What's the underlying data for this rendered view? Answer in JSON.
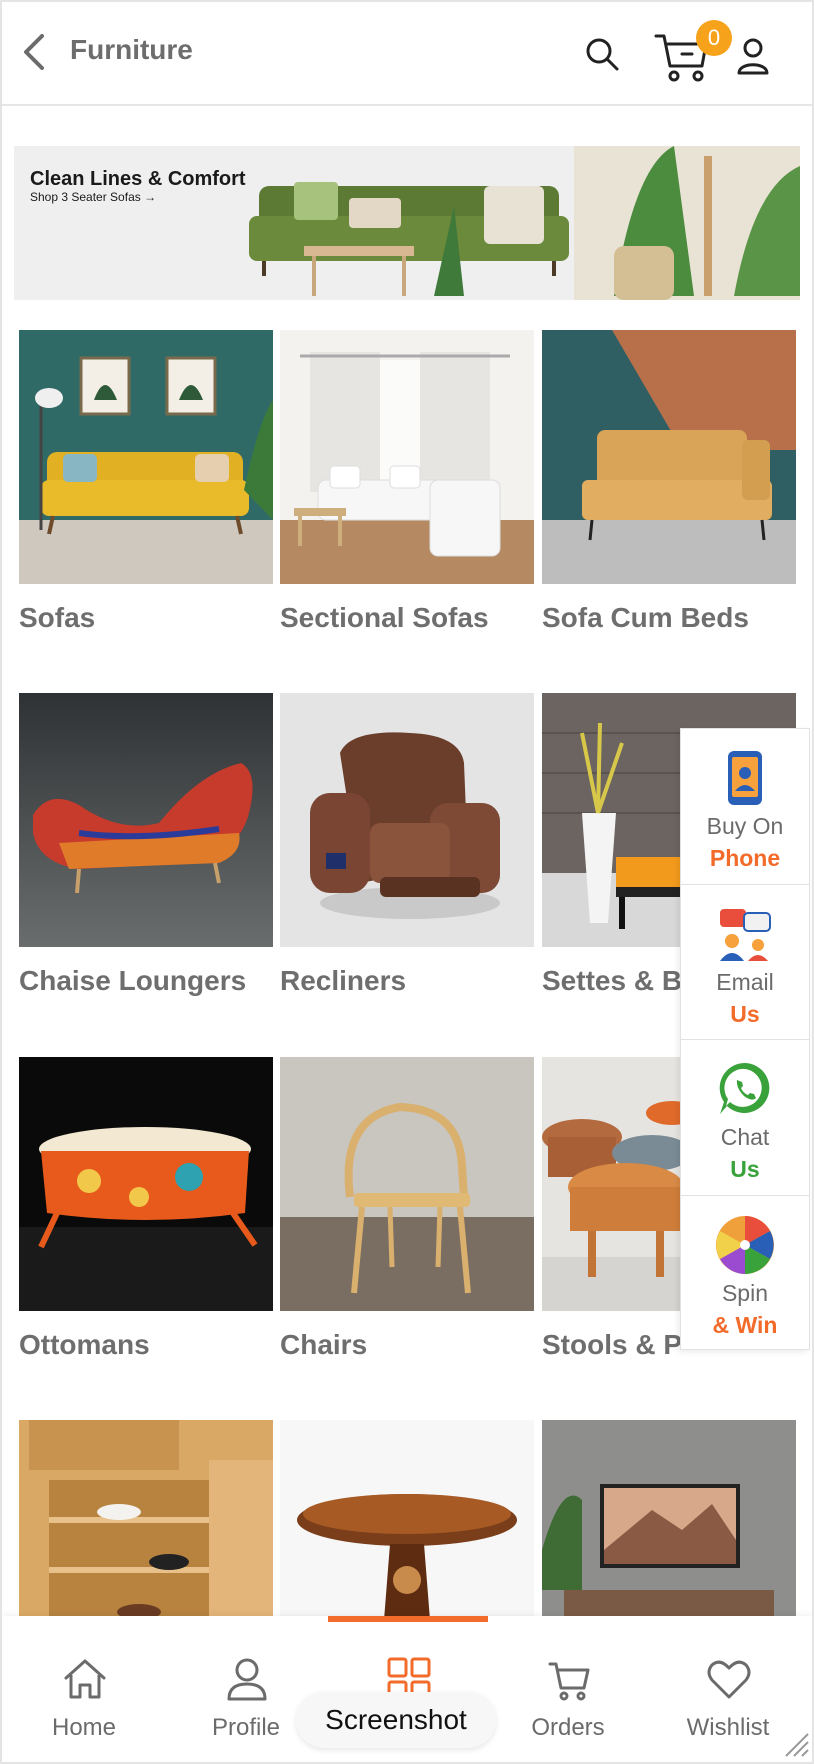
{
  "header": {
    "title": "Furniture",
    "cart_count": "0",
    "icons": [
      "back-icon",
      "search-icon",
      "cart-icon",
      "user-icon"
    ]
  },
  "banner": {
    "title": "Clean Lines & Comfort",
    "subtitle": "Shop 3 Seater Sofas →"
  },
  "categories": [
    {
      "label": "Sofas"
    },
    {
      "label": "Sectional Sofas"
    },
    {
      "label": "Sofa Cum Beds"
    },
    {
      "label": "Chaise Loungers"
    },
    {
      "label": "Recliners"
    },
    {
      "label": "Settes & B"
    },
    {
      "label": "Ottomans"
    },
    {
      "label": "Chairs"
    },
    {
      "label": "Stools & P"
    }
  ],
  "contact": {
    "buy_phone": {
      "line1": "Buy On",
      "line2": "Phone"
    },
    "email": {
      "line1": "Email",
      "line2": "Us"
    },
    "chat": {
      "line1": "Chat",
      "line2": "Us"
    },
    "spin": {
      "line1": "Spin",
      "line2": "& Win"
    }
  },
  "nav": {
    "home": "Home",
    "profile": "Profile",
    "screenshot": "Screenshot",
    "orders": "Orders",
    "wishlist": "Wishlist",
    "active": "screenshot"
  },
  "colors": {
    "accent": "#f26b2a",
    "badge": "#f7a21b",
    "green": "#3aa23a",
    "text_gray": "#6b6b6b"
  }
}
